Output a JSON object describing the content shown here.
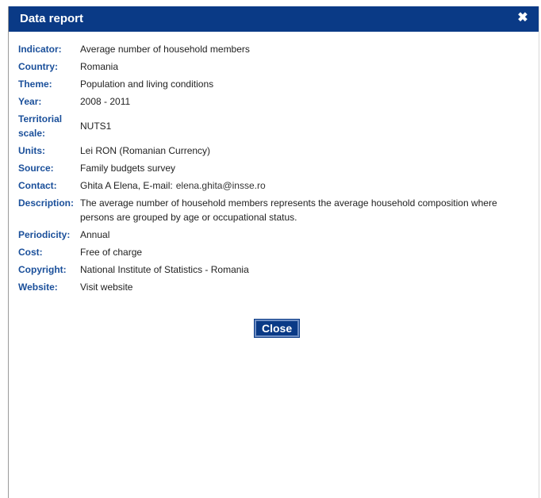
{
  "dialog": {
    "title": "Data report",
    "close_icon": "close-x-icon",
    "close_glyph": "✖",
    "fields": {
      "indicator": {
        "label": "Indicator:",
        "value": "Average number of household members"
      },
      "country": {
        "label": "Country:",
        "value": "Romania"
      },
      "theme": {
        "label": "Theme:",
        "value": "Population and living conditions"
      },
      "year": {
        "label": "Year:",
        "value": "2008 - 2011"
      },
      "territorial": {
        "label_line1": "Territorial",
        "label_line2": "scale:",
        "value": "NUTS1"
      },
      "units": {
        "label": "Units:",
        "value": "Lei RON (Romanian Currency)"
      },
      "source": {
        "label": "Source:",
        "value": "Family budgets survey"
      },
      "contact": {
        "label": "Contact:",
        "value": "Ghita A Elena, E-mail:",
        "email": "elena.ghita@insse.ro"
      },
      "description": {
        "label": "Description:",
        "value": "The average number of household members represents the average household composition where persons are grouped by age or occupational status."
      },
      "periodicity": {
        "label": "Periodicity:",
        "value": "Annual"
      },
      "cost": {
        "label": "Cost:",
        "value": "Free of charge"
      },
      "copyright": {
        "label": "Copyright:",
        "value": "National Institute of Statistics - Romania"
      },
      "website": {
        "label": "Website:",
        "link_text": "Visit website"
      }
    },
    "close_button_label": "Close"
  },
  "colors": {
    "titlebar": "#0a3a86",
    "label": "#1a4f9a",
    "text": "#222222"
  }
}
